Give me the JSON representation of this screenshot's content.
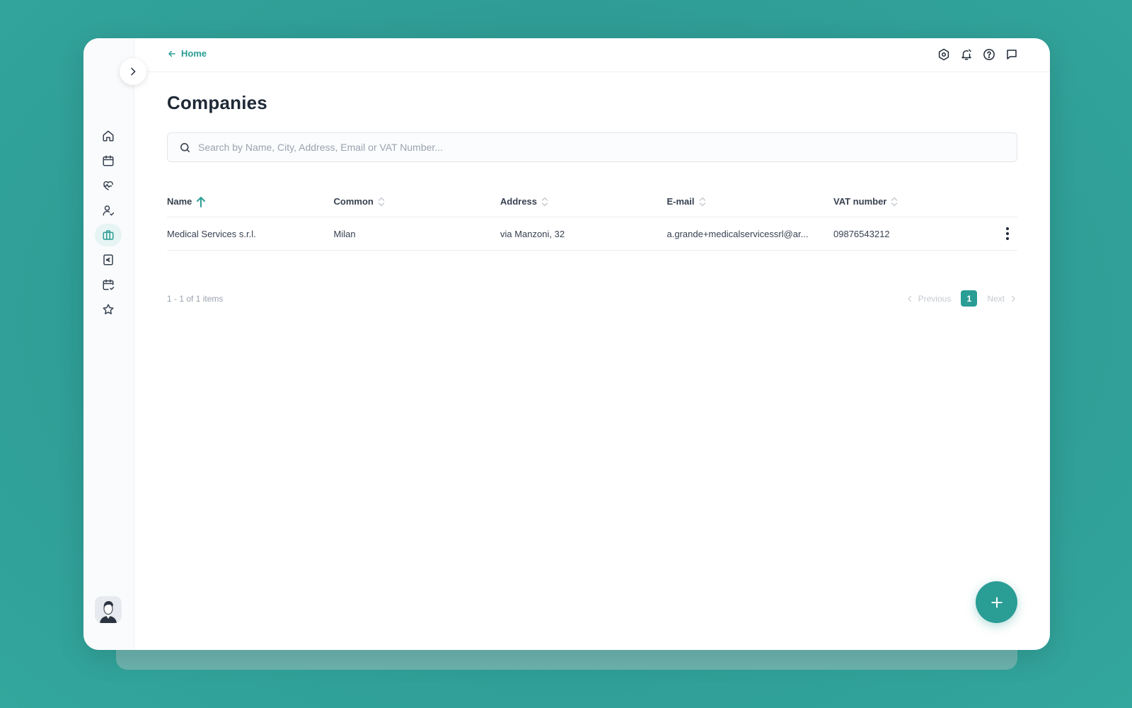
{
  "topbar": {
    "back_label": "Home",
    "icons": [
      "settings-icon",
      "bell-icon",
      "help-icon",
      "chat-icon"
    ]
  },
  "sidebar": {
    "items": [
      {
        "name": "home",
        "icon": "home-icon"
      },
      {
        "name": "calendar",
        "icon": "calendar-icon"
      },
      {
        "name": "health",
        "icon": "heart-icon"
      },
      {
        "name": "users",
        "icon": "user-icon"
      },
      {
        "name": "companies",
        "icon": "briefcase-icon",
        "active": true
      },
      {
        "name": "billing",
        "icon": "euro-icon"
      },
      {
        "name": "schedule",
        "icon": "calendar-check-icon"
      },
      {
        "name": "favorites",
        "icon": "star-icon"
      }
    ]
  },
  "page": {
    "title": "Companies"
  },
  "search": {
    "placeholder": "Search by Name, City, Address, Email or VAT Number..."
  },
  "table": {
    "columns": [
      "Name",
      "Common",
      "Address",
      "E-mail",
      "VAT number"
    ],
    "sorted_column": "Name",
    "rows": [
      {
        "name": "Medical Services s.r.l.",
        "common": "Milan",
        "address": "via Manzoni, 32",
        "email": "a.grande+medicalservicessrl@ar...",
        "vat": "09876543212"
      }
    ]
  },
  "pagination": {
    "summary": "1 - 1 of 1 items",
    "previous": "Previous",
    "next": "Next",
    "current_page": "1"
  },
  "colors": {
    "accent": "#2a9d95",
    "background": "#2f9e96"
  }
}
